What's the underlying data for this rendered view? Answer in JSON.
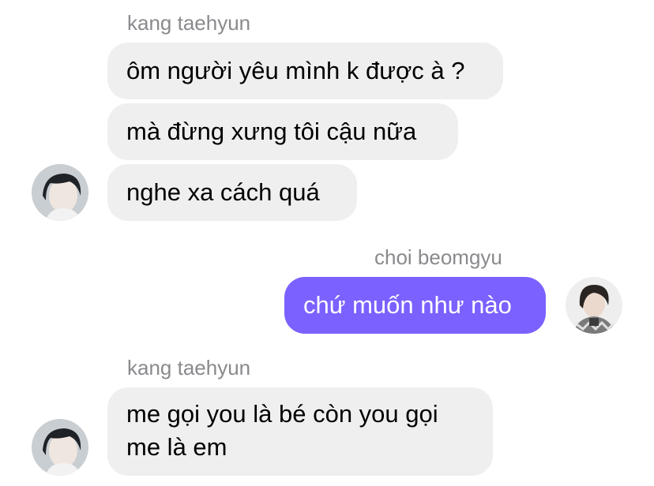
{
  "messages": [
    {
      "sender": "kang taehyun",
      "direction": "incoming",
      "bubbles": [
        "ôm người yêu mình k được à ?",
        "mà đừng xưng tôi cậu nữa",
        "nghe xa cách quá"
      ]
    },
    {
      "sender": "choi beomgyu",
      "direction": "outgoing",
      "bubbles": [
        "chứ muốn như nào"
      ]
    },
    {
      "sender": "kang taehyun",
      "direction": "incoming",
      "bubbles": [
        "me gọi you là bé còn you gọi me là em"
      ]
    }
  ],
  "colors": {
    "incoming_bubble": "#efefef",
    "outgoing_bubble": "#7b61ff",
    "sender_label": "#8a8a8e"
  },
  "icons": {
    "incoming_avatar": "avatar-kang-taehyun",
    "outgoing_avatar": "avatar-choi-beomgyu"
  }
}
